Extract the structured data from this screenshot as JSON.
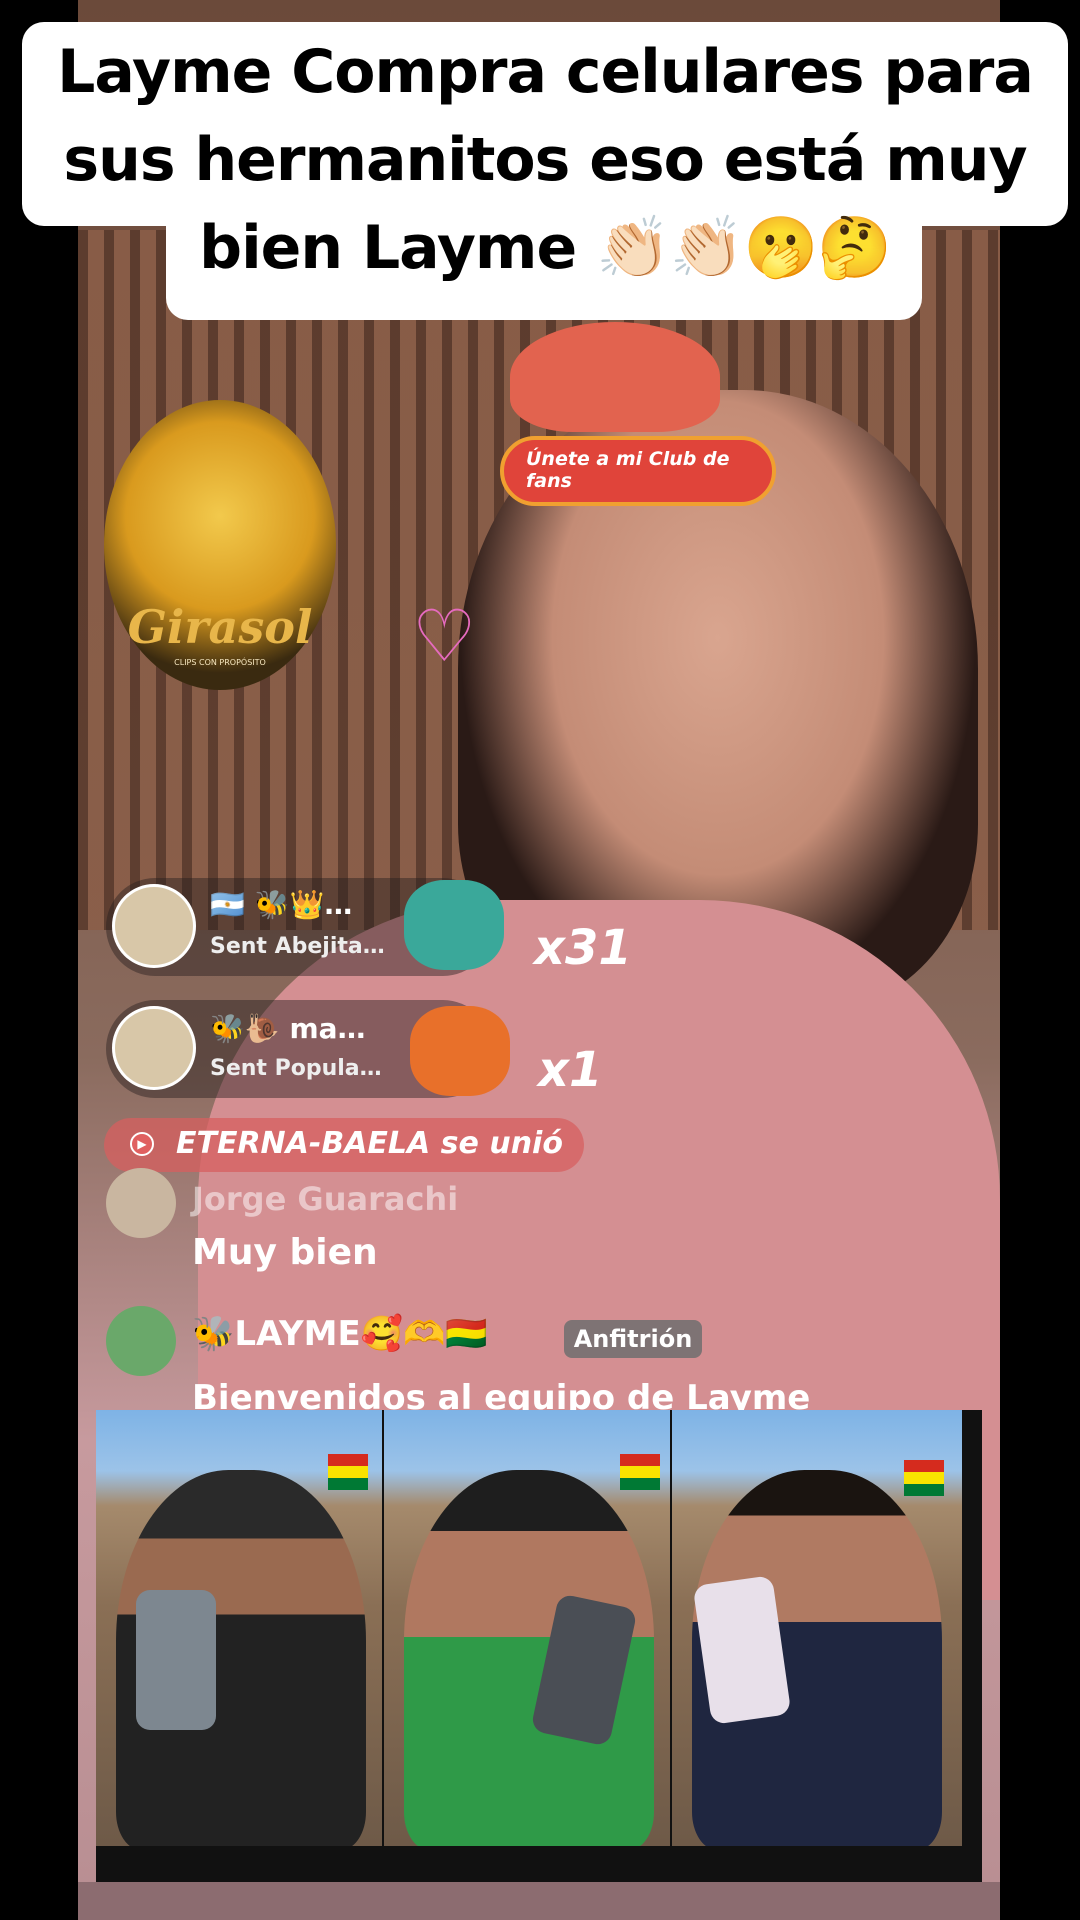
{
  "caption": {
    "line1": "Layme Compra celulares para",
    "line2": "sus hermanitos eso está muy",
    "line3": "bien Layme 👏🏻👏🏻🫢🤔"
  },
  "fan_club_button": {
    "label": "Únete a mi Club de fans"
  },
  "watermark": {
    "name": "Girasol",
    "tagline": "CLIPS CON PROPÓSITO"
  },
  "gifts": [
    {
      "user_emojis": "🇦🇷 🐝👑…",
      "sent_label": "Sent Abejita…",
      "combo": "x31",
      "gift_name": "Abejita"
    },
    {
      "user_emojis": "🐝🐌 ma…",
      "sent_label": "Sent Popula…",
      "combo": "x1",
      "gift_name": "POPULAR"
    }
  ],
  "join_notice": {
    "text": "ETERNA-BAELA se unió",
    "icon": "tv-icon"
  },
  "comments": [
    {
      "user": "Jorge Guarachi",
      "text": "Muy bien"
    },
    {
      "user": "🐝LAYME🥰🫶🇧🇴",
      "badge": "Anfitrión",
      "text": "Bienvenidos al equipo de Layme"
    }
  ],
  "colors": {
    "caption_bg": "#ffffff",
    "club_button": "#e0443a",
    "sweater": "#d48f92",
    "heart": "#e66bbf"
  },
  "collage": {
    "panels": [
      {
        "subject": "boy-cap-phone"
      },
      {
        "subject": "boy-green-shirt-phone"
      },
      {
        "subject": "girl-headband-phone"
      }
    ]
  }
}
